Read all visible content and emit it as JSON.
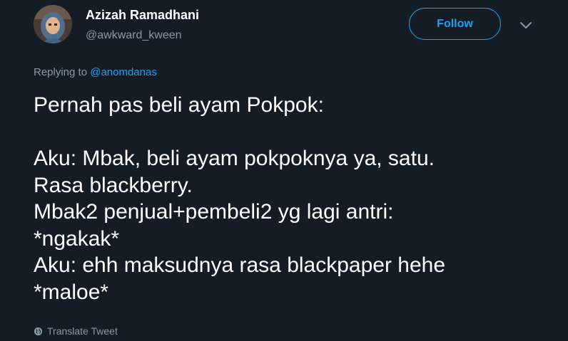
{
  "author": {
    "display_name": "Azizah Ramadhani",
    "handle": "@awkward_kween",
    "avatar_icon": "user-avatar"
  },
  "follow_label": "Follow",
  "more_icon": "chevron-down-icon",
  "reply": {
    "prefix": "Replying to",
    "target": "@anomdanas"
  },
  "tweet": {
    "text": "Pernah pas beli ayam Pokpok:\n\nAku: Mbak, beli ayam pokpoknya ya, satu.\nRasa blackberry.\nMbak2 penjual+pembeli2 yg lagi antri:\n*ngakak*\nAku: ehh maksudnya rasa blackpaper hehe\n*maloe*"
  },
  "translate_label": "Translate Tweet",
  "colors": {
    "background": "#141d26",
    "accent": "#1da1f2",
    "secondary_text": "#8899a6",
    "primary_text": "#ffffff"
  }
}
